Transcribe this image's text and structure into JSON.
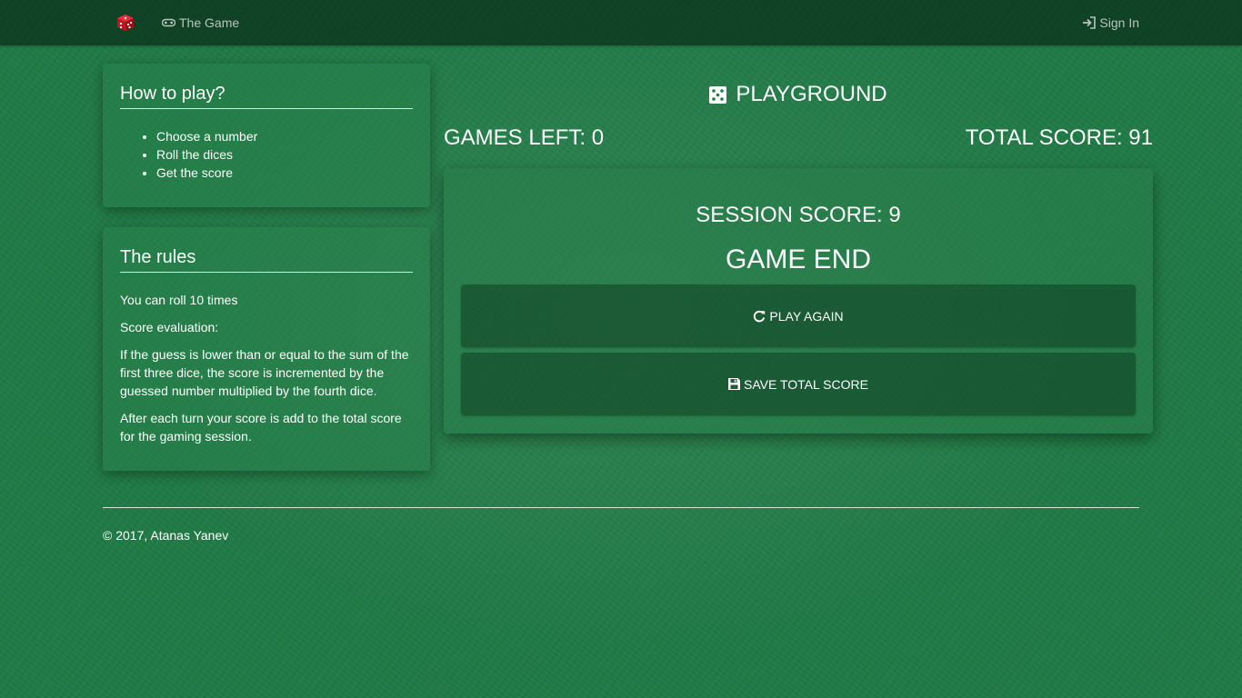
{
  "navbar": {
    "brand_icon": "red-dice-icon",
    "game_link": "The Game",
    "game_icon": "gamepad-icon",
    "signin_link": "Sign In",
    "signin_icon": "sign-in-icon"
  },
  "howto": {
    "title": "How to play?",
    "steps": [
      "Choose a number",
      "Roll the dices",
      "Get the score"
    ]
  },
  "rules": {
    "title": "The rules",
    "paragraphs": [
      "You can roll 10 times",
      "Score evaluation:",
      "If the guess is lower than or equal to the sum of the first three dice, the score is incremented by the guessed number multiplied by the fourth dice.",
      "After each turn your score is add to the total score for the gaming session."
    ]
  },
  "main": {
    "title": "PLAYGROUND",
    "title_icon": "dice-icon",
    "games_left": "GAMES LEFT: 0",
    "total_score": "TOTAL SCORE: 91",
    "session_score": "SESSION SCORE: 9",
    "status": "GAME END",
    "play_again_label": "PLAY AGAIN",
    "play_again_icon": "refresh-icon",
    "save_label": "SAVE TOTAL SCORE",
    "save_icon": "floppy-disk-icon"
  },
  "footer": {
    "copyright": "© 2017, Atanas Yanev"
  },
  "colors": {
    "background": "#1f7a45",
    "brand_dice": "#c0171f"
  }
}
